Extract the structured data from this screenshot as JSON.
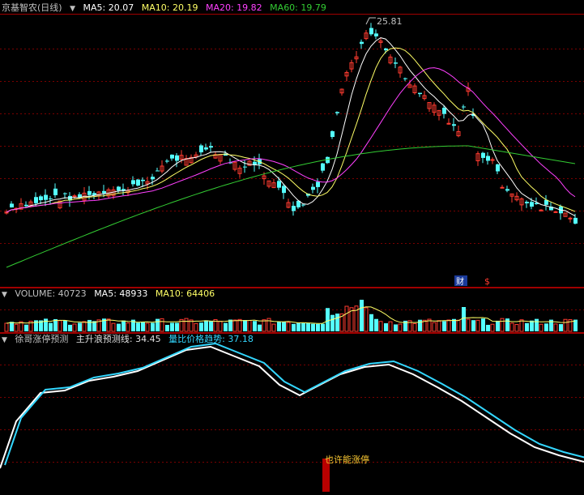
{
  "colors": {
    "background": "#000000",
    "grid": "#7a0000",
    "up": "#ff3b30",
    "down": "#54ffff",
    "ma5": "#ffffff",
    "ma10": "#ffff66",
    "ma20": "#ff40ff",
    "ma60": "#33cc33",
    "indicator_main": "#ffffff",
    "indicator_trend": "#33d7ff",
    "signal": "#b80000",
    "signal_text": "#ffcc33"
  },
  "price_panel": {
    "title": "京基智农(日线)",
    "ma5": "MA5: 20.07",
    "ma10": "MA10: 20.19",
    "ma20": "MA20: 19.82",
    "ma60": "MA60: 19.79",
    "high_label": "25.81",
    "marker_fin": "财",
    "marker_dollar": "$"
  },
  "volume_panel": {
    "volume": "VOLUME: 40723",
    "ma5": "MA5: 48933",
    "ma10": "MA10: 64406"
  },
  "indicator_panel": {
    "title": "徐哥涨停预测",
    "line1": "主升浪预测线: 34.45",
    "line2": "量比价格趋势: 37.18",
    "signal_text": "也许能涨停"
  },
  "chart_data": [
    {
      "type": "candlestick",
      "title": "京基智农(日线)",
      "series": [
        {
          "name": "MA5",
          "last": 20.07
        },
        {
          "name": "MA10",
          "last": 20.19
        },
        {
          "name": "MA20",
          "last": 19.82
        },
        {
          "name": "MA60",
          "last": 19.79
        }
      ],
      "annotations": [
        {
          "label": "25.81",
          "kind": "high"
        }
      ]
    },
    {
      "type": "bar",
      "title": "VOLUME",
      "series": [
        {
          "name": "VOLUME",
          "last": 40723
        },
        {
          "name": "MA5",
          "last": 48933
        },
        {
          "name": "MA10",
          "last": 64406
        }
      ]
    },
    {
      "type": "line",
      "title": "徐哥涨停预测",
      "series": [
        {
          "name": "主升浪预测线",
          "last": 34.45
        },
        {
          "name": "量比价格趋势",
          "last": 37.18
        }
      ],
      "annotations": [
        {
          "label": "也许能涨停",
          "kind": "signal"
        }
      ]
    }
  ]
}
